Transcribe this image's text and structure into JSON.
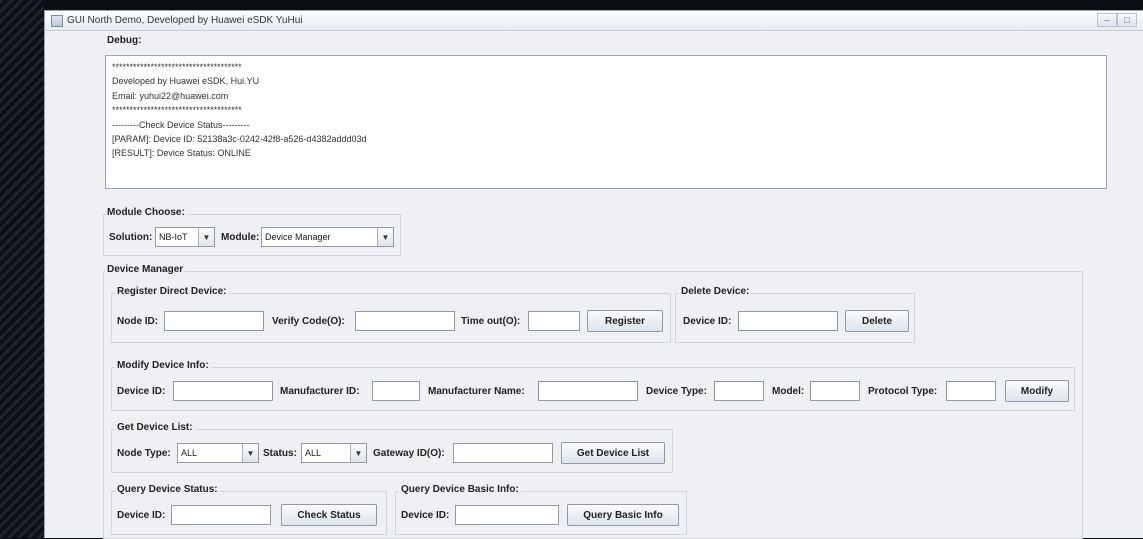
{
  "window": {
    "title": "GUI North Demo, Developed by Huawei eSDK YuHui",
    "min_symbol": "‒",
    "max_symbol": "□"
  },
  "debug": {
    "label": "Debug:",
    "lines": [
      "*************************************",
      "Developed by Huawei eSDK, Hui.YU",
      "Email: yuhui22@huawei.com",
      "*************************************",
      "---------Check Device Status---------",
      "[PARAM]: Device ID: 52138a3c-0242-42f8-a526-d4382addd03d",
      "[RESULT]: Device Status: ONLINE"
    ]
  },
  "module_choose": {
    "title": "Module Choose:",
    "solution_label": "Solution:",
    "solution_value": "NB-IoT",
    "module_label": "Module:",
    "module_value": "Device Manager"
  },
  "device_manager": {
    "title": "Device Manager",
    "register": {
      "title": "Register Direct Device:",
      "node_id_label": "Node ID:",
      "verify_code_label": "Verify Code(O):",
      "timeout_label": "Time out(O):",
      "button": "Register"
    },
    "delete": {
      "title": "Delete Device:",
      "device_id_label": "Device ID:",
      "button": "Delete"
    },
    "modify": {
      "title": "Modify Device Info:",
      "device_id_label": "Device ID:",
      "manufacturer_id_label": "Manufacturer ID:",
      "manufacturer_name_label": "Manufacturer Name:",
      "device_type_label": "Device Type:",
      "model_label": "Model:",
      "protocol_type_label": "Protocol Type:",
      "button": "Modify"
    },
    "get_list": {
      "title": "Get Device List:",
      "node_type_label": "Node Type:",
      "node_type_value": "ALL",
      "status_label": "Status:",
      "status_value": "ALL",
      "gateway_label": "Gateway ID(O):",
      "button": "Get Device List"
    },
    "query_status": {
      "title": "Query Device Status:",
      "device_id_label": "Device ID:",
      "button": "Check Status"
    },
    "query_basic": {
      "title": "Query Device Basic Info:",
      "device_id_label": "Device ID:",
      "button": "Query Basic Info"
    }
  }
}
